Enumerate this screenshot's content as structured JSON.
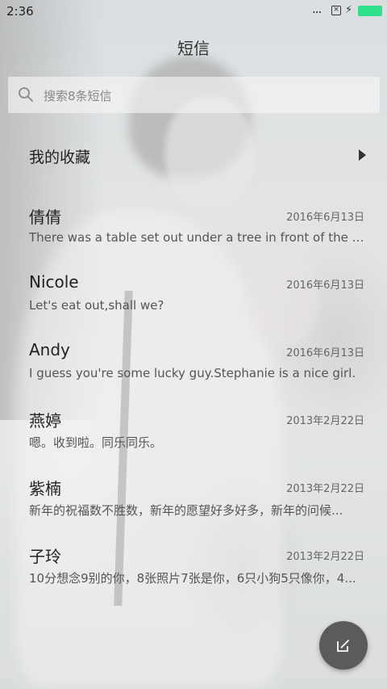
{
  "status_bar": {
    "time": "2:36",
    "dots": "...",
    "sim_icon": "sim-off-icon",
    "charging_icon": "plug-icon",
    "battery_color": "#2ee08a"
  },
  "header": {
    "title": "短信"
  },
  "search": {
    "placeholder": "搜索8条短信",
    "icon": "search-icon"
  },
  "favorites": {
    "label": "我的收藏",
    "icon": "chevron-right-icon"
  },
  "threads": [
    {
      "name": "倩倩",
      "date": "2016年6月13日",
      "preview": "There was a table set out under a tree in front of the house..."
    },
    {
      "name": "Nicole",
      "date": "2016年6月13日",
      "preview": "Let's eat out,shall we?"
    },
    {
      "name": "Andy",
      "date": "2016年6月13日",
      "preview": "I guess you're some lucky guy.Stephanie is a nice girl."
    },
    {
      "name": "燕婷",
      "date": "2013年2月22日",
      "preview": "嗯。收到啦。同乐同乐。"
    },
    {
      "name": "紫楠",
      "date": "2013年2月22日",
      "preview": "新年的祝福数不胜数，新年的愿望好多好多，新年的问候..."
    },
    {
      "name": "子玲",
      "date": "2013年2月22日",
      "preview": "10分想念9别的你，8张照片7张是你，6只小狗5只像你，4..."
    }
  ],
  "compose": {
    "icon": "compose-icon",
    "color": "#5b5b5b"
  }
}
